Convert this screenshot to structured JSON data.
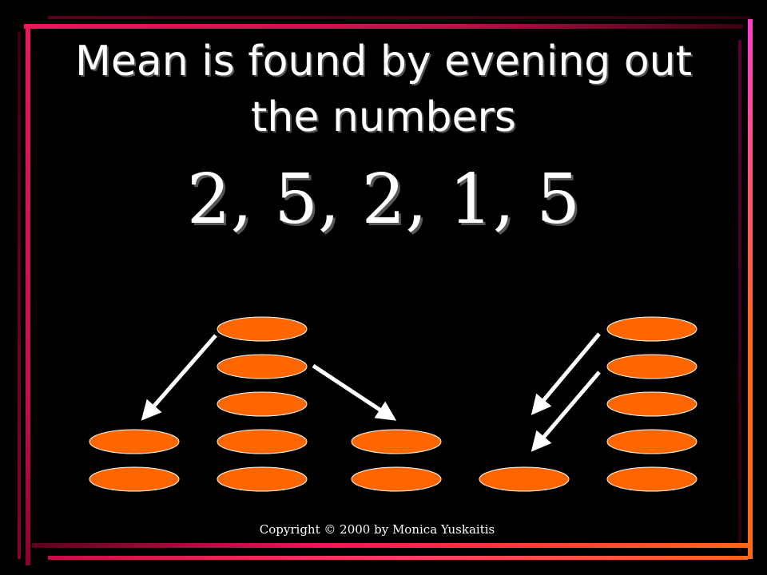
{
  "slide": {
    "title": "Mean is found by evening out the numbers",
    "numbers": "2, 5, 2, 1, 5",
    "copyright": "Copyright © 2000 by Monica Yuskaitis"
  },
  "stacks": [
    2,
    5,
    2,
    1,
    5
  ],
  "colors": {
    "background": "#000000",
    "disc_fill": "#ff6600",
    "disc_stroke": "#ffffff",
    "arrow": "#ffffff",
    "border_red": "#e8185a",
    "border_orange": "#ff6a1a",
    "border_magenta": "#ff3fd0"
  }
}
